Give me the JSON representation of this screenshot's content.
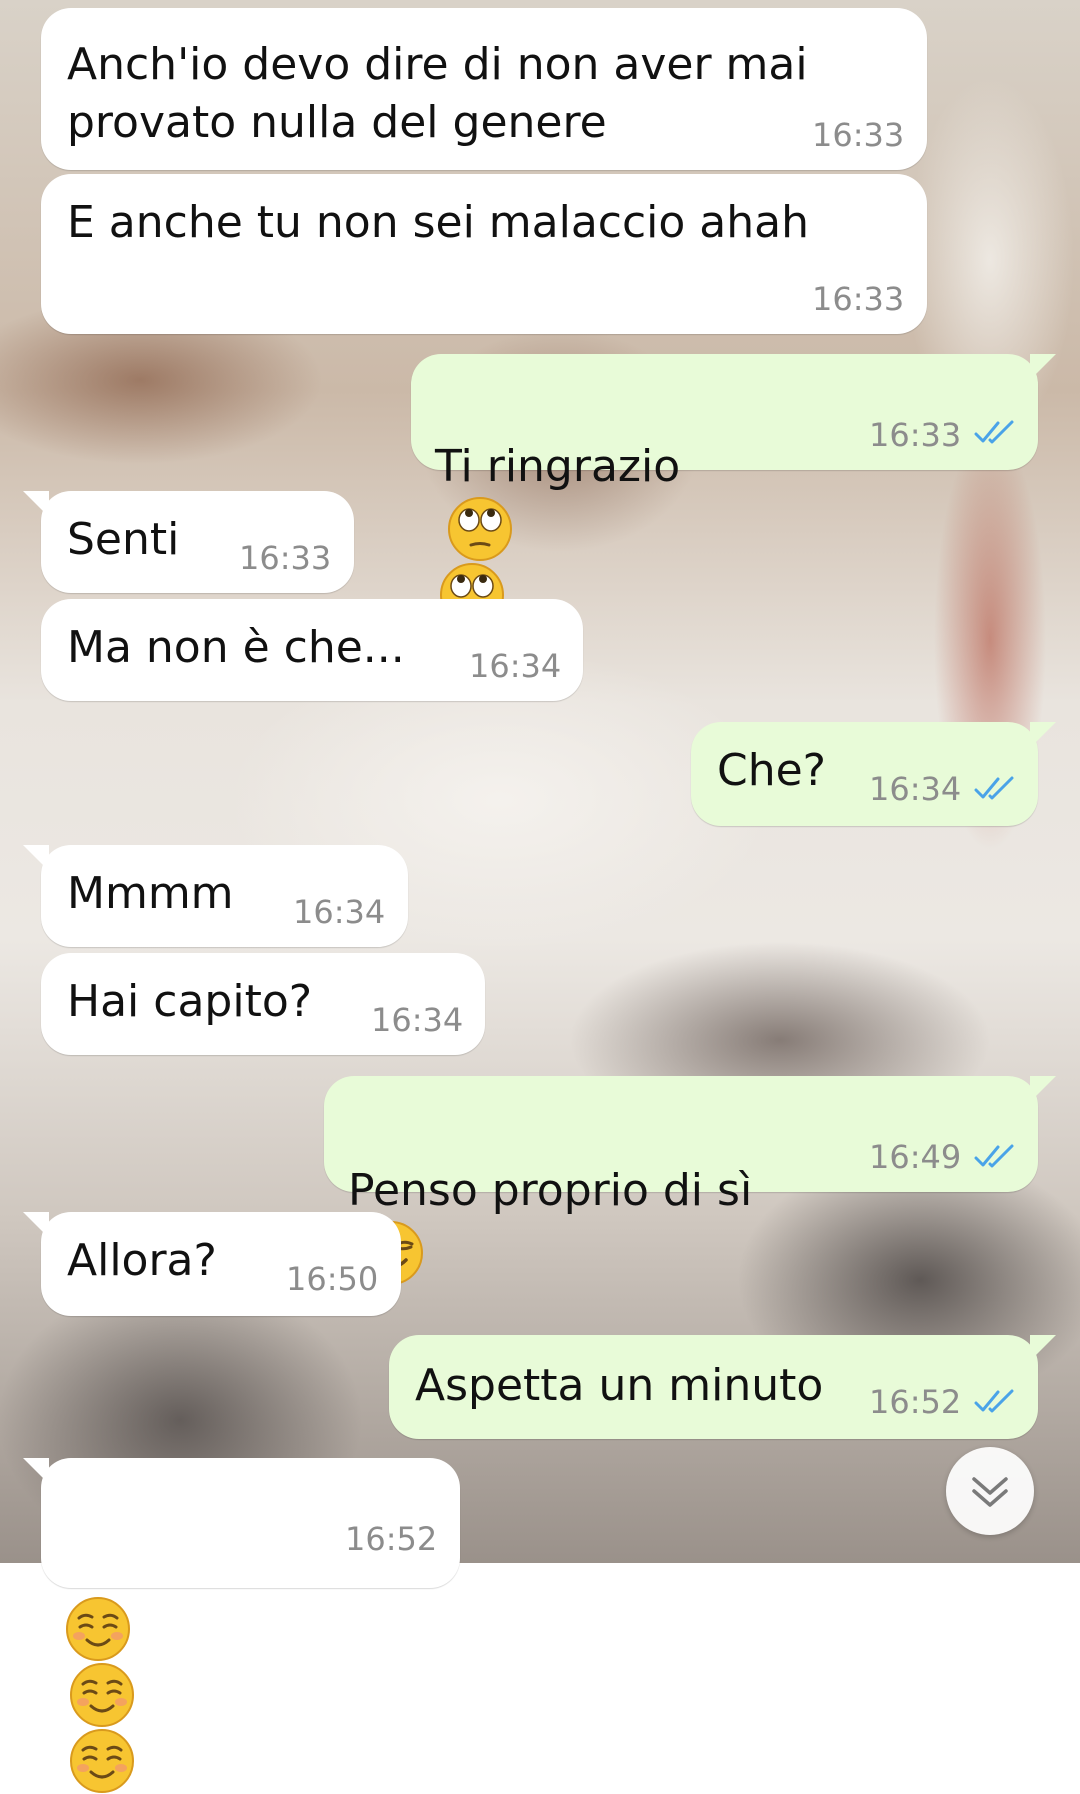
{
  "messages": [
    {
      "text": "Anch'io devo dire di non aver mai\nprovato nulla del genere",
      "time": "16:33",
      "direction": "incoming"
    },
    {
      "text": "E anche tu non sei malaccio ahah",
      "time": "16:33",
      "direction": "incoming"
    },
    {
      "text": "Ti ringrazio",
      "time": "16:33",
      "direction": "outgoing",
      "emoji": [
        "face-with-rolling-eyes",
        "face-with-rolling-eyes"
      ],
      "status": "read"
    },
    {
      "text": "Senti",
      "time": "16:33",
      "direction": "incoming"
    },
    {
      "text": "Ma non è che...",
      "time": "16:34",
      "direction": "incoming"
    },
    {
      "text": "Che?",
      "time": "16:34",
      "direction": "outgoing",
      "status": "read"
    },
    {
      "text": "Mmmm",
      "time": "16:34",
      "direction": "incoming"
    },
    {
      "text": "Hai capito?",
      "time": "16:34",
      "direction": "incoming"
    },
    {
      "text": "Penso proprio di sì",
      "time": "16:49",
      "direction": "outgoing",
      "emoji": [
        "smirking-face"
      ],
      "status": "read"
    },
    {
      "text": "Allora?",
      "time": "16:50",
      "direction": "incoming"
    },
    {
      "text": "Aspetta un minuto",
      "time": "16:52",
      "direction": "outgoing",
      "status": "read"
    },
    {
      "text": "",
      "time": "16:52",
      "direction": "incoming",
      "emoji": [
        "smiling-face",
        "smiling-face",
        "smiling-face"
      ]
    }
  ],
  "scroll_button_icon": "double-chevron-down-icon",
  "colors": {
    "incoming": "#ffffff",
    "outgoing": "#e8fbd8",
    "read_ticks": "#4aa3e8",
    "time": "#8c8c8c"
  }
}
